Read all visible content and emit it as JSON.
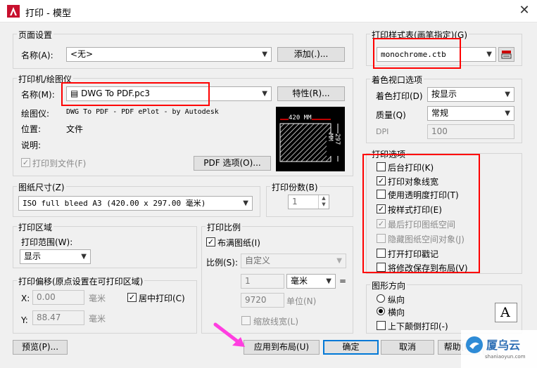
{
  "window": {
    "title": "打印 - 模型",
    "close": "✕"
  },
  "page_setup": {
    "title": "页面设置",
    "name_label": "名称(A):",
    "name_value": "<无>",
    "add_button": "添加(.)..."
  },
  "printer": {
    "title": "打印机/绘图仪",
    "name_label": "名称(M):",
    "name_value": "DWG To PDF.pc3",
    "properties_button": "特性(R)...",
    "plotter_label": "绘图仪:",
    "plotter_value": "DWG To PDF - PDF ePlot - by Autodesk",
    "location_label": "位置:",
    "location_value": "文件",
    "desc_label": "说明:",
    "print_to_file": "打印到文件(F)",
    "pdf_options_button": "PDF 选项(O)...",
    "preview_width": "420 MM",
    "preview_height": "297 MM"
  },
  "paper_size": {
    "title": "图纸尺寸(Z)",
    "value": "ISO full bleed A3 (420.00 x 297.00 毫米)"
  },
  "copies": {
    "title": "打印份数(B)",
    "value": "1"
  },
  "plot_area": {
    "title": "打印区域",
    "range_label": "打印范围(W):",
    "range_value": "显示"
  },
  "plot_offset": {
    "title": "打印偏移(原点设置在可打印区域)",
    "x_label": "X:",
    "x_value": "0.00",
    "x_unit": "毫米",
    "y_label": "Y:",
    "y_value": "88.47",
    "y_unit": "毫米",
    "center_label": "居中打印(C)"
  },
  "plot_scale": {
    "title": "打印比例",
    "fit_label": "布满图纸(I)",
    "scale_label": "比例(S):",
    "scale_value": "自定义",
    "val1": "1",
    "unit_value": "毫米",
    "equals": "=",
    "val2": "9720",
    "unit2": "单位(N)",
    "lineweights_label": "缩放线宽(L)"
  },
  "plot_style_table": {
    "title": "打印样式表(画笔指定)(G)",
    "value": "monochrome.ctb"
  },
  "shaded_viewport": {
    "title": "着色视口选项",
    "shade_label": "着色打印(D)",
    "shade_value": "按显示",
    "quality_label": "质量(Q)",
    "quality_value": "常规",
    "dpi_label": "DPI",
    "dpi_value": "100"
  },
  "plot_options": {
    "title": "打印选项",
    "items": [
      {
        "label": "后台打印(K)",
        "mark": ""
      },
      {
        "label": "打印对象线宽",
        "mark": "✓"
      },
      {
        "label": "使用透明度打印(T)",
        "mark": ""
      },
      {
        "label": "按样式打印(E)",
        "mark": "✓"
      },
      {
        "label": "最后打印图纸空间",
        "mark": "✓"
      },
      {
        "label": "隐藏图纸空间对象(J)",
        "mark": ""
      },
      {
        "label": "打开打印戳记",
        "mark": ""
      },
      {
        "label": "将修改保存到布局(V)",
        "mark": ""
      }
    ]
  },
  "orientation": {
    "title": "图形方向",
    "portrait": "纵向",
    "landscape": "横向",
    "upside_down": "上下颠倒打印(-)",
    "glyph": "A"
  },
  "buttons": {
    "preview": "预览(P)...",
    "apply": "应用到布局(U)",
    "ok": "确定",
    "cancel": "取消",
    "help": "帮助(H)"
  },
  "watermark": {
    "brand": "厦乌云",
    "site": "shaniaoyun.com"
  },
  "colors": {
    "accent": "#0078d7",
    "highlight": "#ff0000",
    "arrow": "#ff3ee0"
  }
}
